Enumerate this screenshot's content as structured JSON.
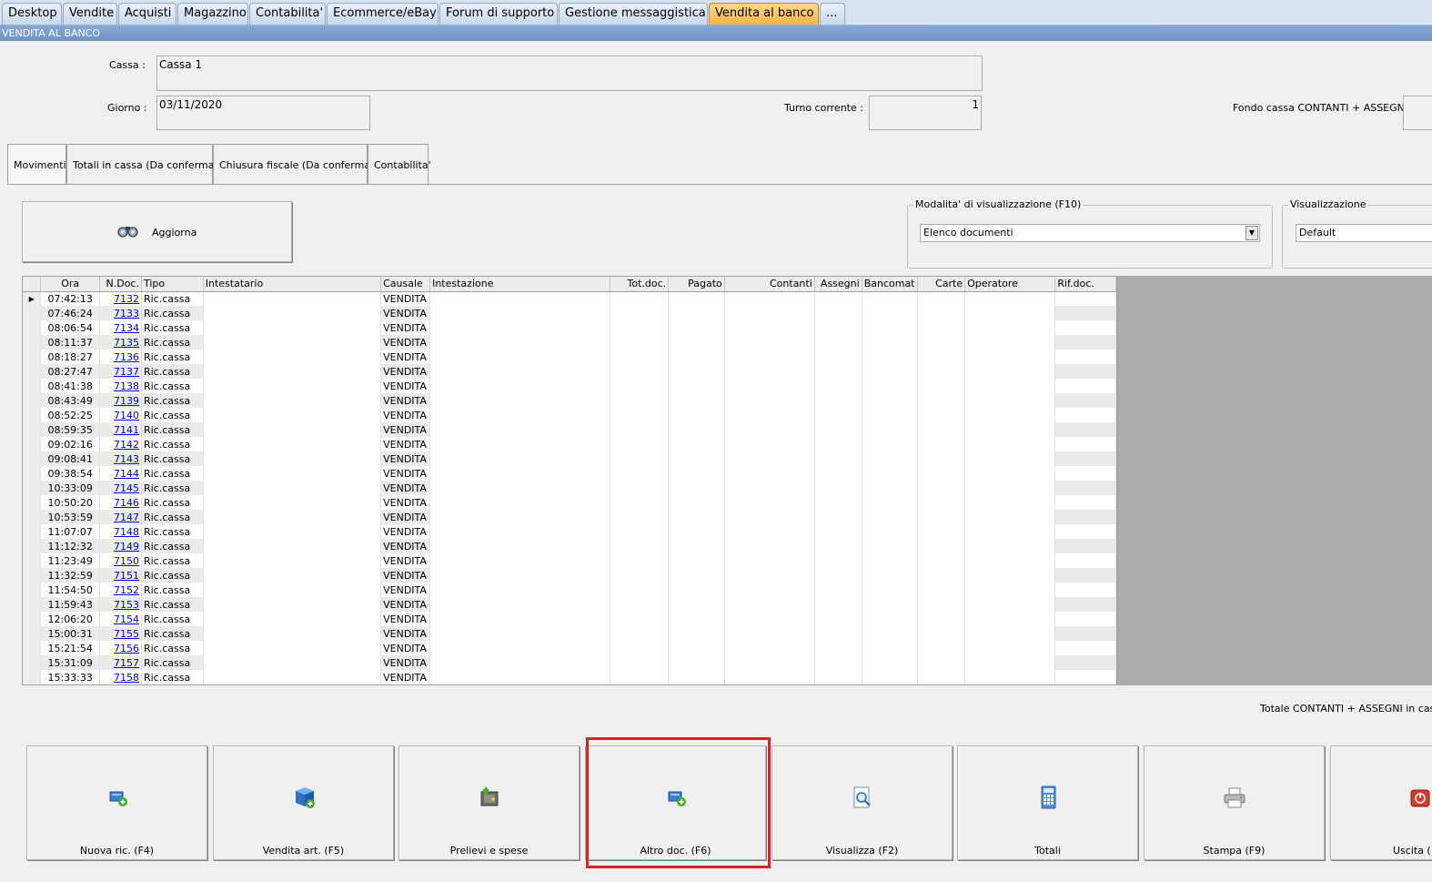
{
  "top_tabs": [
    "Desktop",
    "Vendite",
    "Acquisti",
    "Magazzino",
    "Contabilita'",
    "Ecommerce/eBay",
    "Forum di supporto",
    "Gestione messaggistica",
    "Vendita al banco",
    "..."
  ],
  "section_title": "VENDITA AL BANCO",
  "header": {
    "cassa_label": "Cassa :",
    "cassa_value": "Cassa 1",
    "giorno_label": "Giorno :",
    "giorno_value": "03/11/2020",
    "turno_label": "Turno corrente :",
    "turno_value": "1",
    "fondo_label": "Fondo cassa CONTANTI + ASSEGNI :"
  },
  "sub_tabs": [
    "Movimenti",
    "Totali in cassa (Da confermare)",
    "Chiusura fiscale (Da confermare)",
    "Contabilita'"
  ],
  "aggiorna_label": "Aggiorna",
  "modalita": {
    "title": "Modalita' di visualizzazione (F10)",
    "value": "Elenco documenti"
  },
  "visualizzazione": {
    "title": "Visualizzazione",
    "value": "Default"
  },
  "columns": [
    "Ora",
    "N.Doc.",
    "Tipo",
    "Intestatario",
    "Causale",
    "Intestazione",
    "Tot.doc.",
    "Pagato",
    "Contanti",
    "Assegni",
    "Bancomat",
    "Carte",
    "Operatore",
    "Rif.doc."
  ],
  "rows": [
    {
      "ora": "07:42:13",
      "ndoc": "7132",
      "tipo": "Ric.cassa",
      "causale": "VENDITA"
    },
    {
      "ora": "07:46:24",
      "ndoc": "7133",
      "tipo": "Ric.cassa",
      "causale": "VENDITA"
    },
    {
      "ora": "08:06:54",
      "ndoc": "7134",
      "tipo": "Ric.cassa",
      "causale": "VENDITA"
    },
    {
      "ora": "08:11:37",
      "ndoc": "7135",
      "tipo": "Ric.cassa",
      "causale": "VENDITA"
    },
    {
      "ora": "08:18:27",
      "ndoc": "7136",
      "tipo": "Ric.cassa",
      "causale": "VENDITA"
    },
    {
      "ora": "08:27:47",
      "ndoc": "7137",
      "tipo": "Ric.cassa",
      "causale": "VENDITA"
    },
    {
      "ora": "08:41:38",
      "ndoc": "7138",
      "tipo": "Ric.cassa",
      "causale": "VENDITA"
    },
    {
      "ora": "08:43:49",
      "ndoc": "7139",
      "tipo": "Ric.cassa",
      "causale": "VENDITA"
    },
    {
      "ora": "08:52:25",
      "ndoc": "7140",
      "tipo": "Ric.cassa",
      "causale": "VENDITA"
    },
    {
      "ora": "08:59:35",
      "ndoc": "7141",
      "tipo": "Ric.cassa",
      "causale": "VENDITA"
    },
    {
      "ora": "09:02:16",
      "ndoc": "7142",
      "tipo": "Ric.cassa",
      "causale": "VENDITA"
    },
    {
      "ora": "09:08:41",
      "ndoc": "7143",
      "tipo": "Ric.cassa",
      "causale": "VENDITA"
    },
    {
      "ora": "09:38:54",
      "ndoc": "7144",
      "tipo": "Ric.cassa",
      "causale": "VENDITA"
    },
    {
      "ora": "10:33:09",
      "ndoc": "7145",
      "tipo": "Ric.cassa",
      "causale": "VENDITA"
    },
    {
      "ora": "10:50:20",
      "ndoc": "7146",
      "tipo": "Ric.cassa",
      "causale": "VENDITA"
    },
    {
      "ora": "10:53:59",
      "ndoc": "7147",
      "tipo": "Ric.cassa",
      "causale": "VENDITA"
    },
    {
      "ora": "11:07:07",
      "ndoc": "7148",
      "tipo": "Ric.cassa",
      "causale": "VENDITA"
    },
    {
      "ora": "11:12:32",
      "ndoc": "7149",
      "tipo": "Ric.cassa",
      "causale": "VENDITA"
    },
    {
      "ora": "11:23:49",
      "ndoc": "7150",
      "tipo": "Ric.cassa",
      "causale": "VENDITA"
    },
    {
      "ora": "11:32:59",
      "ndoc": "7151",
      "tipo": "Ric.cassa",
      "causale": "VENDITA"
    },
    {
      "ora": "11:54:50",
      "ndoc": "7152",
      "tipo": "Ric.cassa",
      "causale": "VENDITA"
    },
    {
      "ora": "11:59:43",
      "ndoc": "7153",
      "tipo": "Ric.cassa",
      "causale": "VENDITA"
    },
    {
      "ora": "12:06:20",
      "ndoc": "7154",
      "tipo": "Ric.cassa",
      "causale": "VENDITA"
    },
    {
      "ora": "15:00:31",
      "ndoc": "7155",
      "tipo": "Ric.cassa",
      "causale": "VENDITA"
    },
    {
      "ora": "15:21:54",
      "ndoc": "7156",
      "tipo": "Ric.cassa",
      "causale": "VENDITA"
    },
    {
      "ora": "15:31:09",
      "ndoc": "7157",
      "tipo": "Ric.cassa",
      "causale": "VENDITA"
    },
    {
      "ora": "15:33:33",
      "ndoc": "7158",
      "tipo": "Ric.cassa",
      "causale": "VENDITA"
    }
  ],
  "totale_label": "Totale CONTANTI + ASSEGNI in cassa",
  "buttons": [
    {
      "label": "Nuova ric. (F4)",
      "icon": "new-receipt-icon"
    },
    {
      "label": "Vendita art. (F5)",
      "icon": "sell-article-icon"
    },
    {
      "label": "Prelievi e spese",
      "icon": "withdrawal-icon"
    },
    {
      "label": "Altro doc. (F6)",
      "icon": "other-document-icon"
    },
    {
      "label": "Visualizza (F2)",
      "icon": "magnifier-icon"
    },
    {
      "label": "Totali",
      "icon": "calculator-icon"
    },
    {
      "label": "Stampa (F9)",
      "icon": "printer-icon"
    },
    {
      "label": "Uscita (",
      "icon": "exit-icon"
    }
  ]
}
